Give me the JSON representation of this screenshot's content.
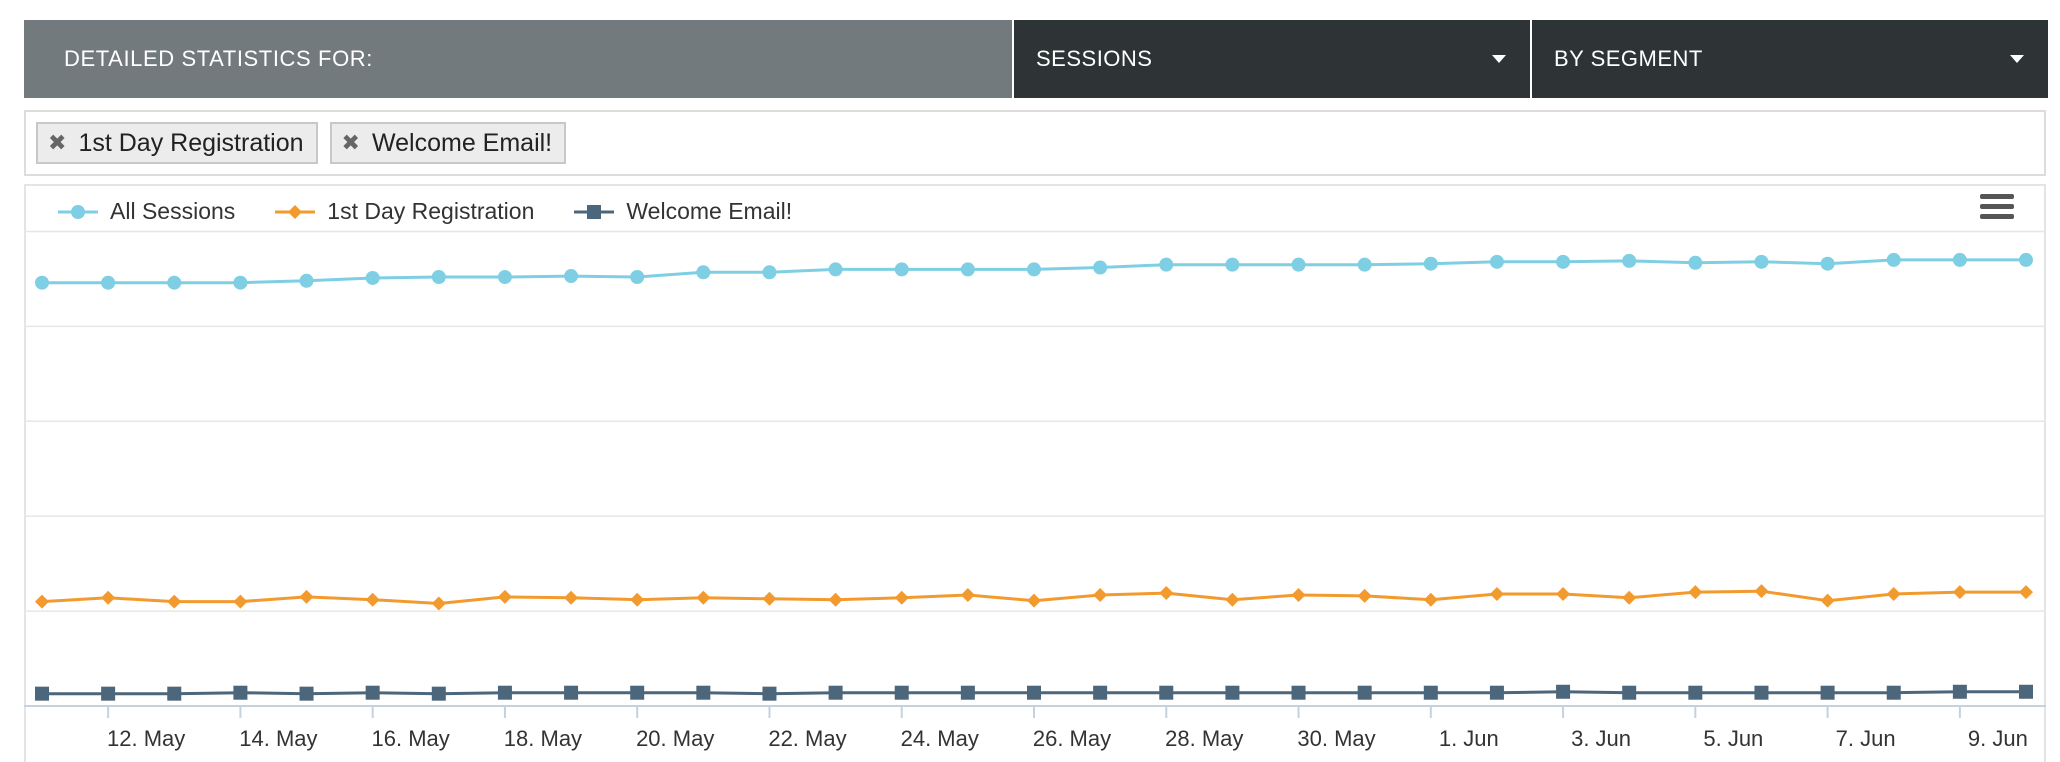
{
  "header": {
    "title": "DETAILED STATISTICS FOR:",
    "metric_select": "SESSIONS",
    "group_select": "BY SEGMENT"
  },
  "filters": {
    "tags": [
      "1st Day Registration",
      "Welcome Email!"
    ],
    "remove_glyph": "✖"
  },
  "colors": {
    "all_sessions": "#7ecfe3",
    "first_day": "#f39a2e",
    "welcome": "#4c667c",
    "grid": "#e6e6e6",
    "axis": "#c4d2e0",
    "header_title_bg": "#727a7d",
    "header_select_bg": "#2e3435"
  },
  "icons": {
    "menu": "hamburger-menu-icon",
    "remove": "close-icon"
  },
  "chart_data": {
    "type": "line",
    "x": [
      "11. May",
      "12. May",
      "13. May",
      "14. May",
      "15. May",
      "16. May",
      "17. May",
      "18. May",
      "19. May",
      "20. May",
      "21. May",
      "22. May",
      "23. May",
      "24. May",
      "25. May",
      "26. May",
      "27. May",
      "28. May",
      "29. May",
      "30. May",
      "31. May",
      "1. Jun",
      "2. Jun",
      "3. Jun",
      "4. Jun",
      "5. Jun",
      "6. Jun",
      "7. Jun",
      "8. Jun",
      "9. Jun",
      "10. Jun"
    ],
    "x_tick_labels": [
      "12. May",
      "14. May",
      "16. May",
      "18. May",
      "20. May",
      "22. May",
      "24. May",
      "26. May",
      "28. May",
      "30. May",
      "1. Jun",
      "3. Jun",
      "5. Jun",
      "7. Jun",
      "9. Jun"
    ],
    "series": [
      {
        "name": "All Sessions",
        "marker": "circle",
        "values": [
          446,
          446,
          446,
          446,
          448,
          451,
          452,
          452,
          453,
          452,
          457,
          457,
          460,
          460,
          460,
          460,
          462,
          465,
          465,
          465,
          465,
          466,
          468,
          468,
          469,
          467,
          468,
          466,
          470,
          470,
          470
        ]
      },
      {
        "name": "1st Day Registration",
        "marker": "diamond",
        "values": [
          110,
          114,
          110,
          110,
          115,
          112,
          108,
          115,
          114,
          112,
          114,
          113,
          112,
          114,
          117,
          111,
          117,
          119,
          112,
          117,
          116,
          112,
          118,
          118,
          114,
          120,
          121,
          111,
          118,
          120,
          120
        ]
      },
      {
        "name": "Welcome Email!",
        "marker": "square",
        "values": [
          13,
          13,
          13,
          14,
          13,
          14,
          13,
          14,
          14,
          14,
          14,
          13,
          14,
          14,
          14,
          14,
          14,
          14,
          14,
          14,
          14,
          14,
          14,
          15,
          14,
          14,
          14,
          14,
          14,
          15,
          15
        ]
      }
    ],
    "ylim": [
      0,
      550
    ],
    "grid": true,
    "legend_position": "top-left"
  }
}
